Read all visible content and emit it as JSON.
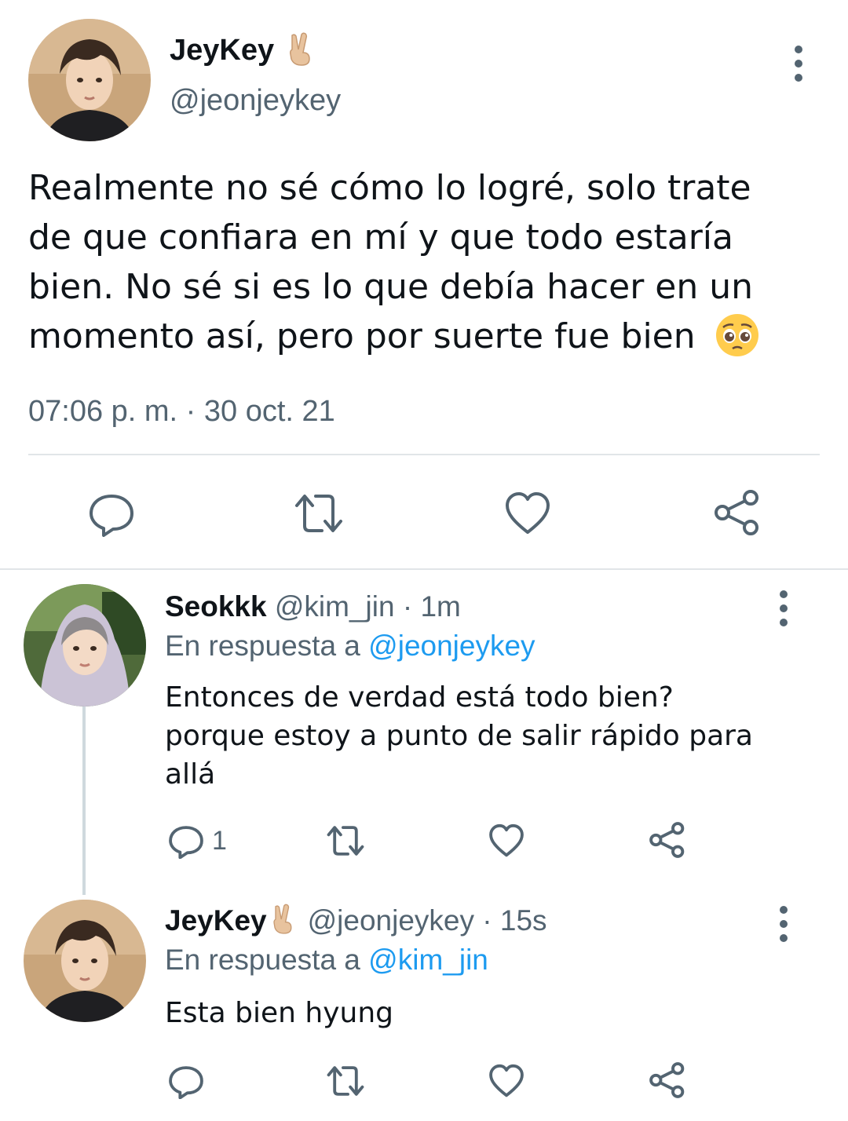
{
  "main_tweet": {
    "author_name": "JeyKey",
    "handle": "@jeonjeykey",
    "text": "Realmente no sé cómo lo logré, solo trate de que confiara en mí y que todo estaría bien. No sé si es lo que debía hacer en un momento así, pero por suerte fue bien",
    "text_lines": [
      "Realmente no sé cómo lo logré, solo trate",
      "de que confiara en mí y que todo estaría",
      "bien. No sé si es lo que debía hacer en un",
      "momento así, pero por suerte fue bien"
    ],
    "timestamp": "07:06 p. m. · 30 oct. 21",
    "author_emoji": "victory-hand-emoji",
    "text_emoji": "pleading-face-emoji",
    "actions": [
      "reply-icon",
      "retweet-icon",
      "like-icon",
      "share-icon"
    ]
  },
  "replies": [
    {
      "author_name": "Seokkk",
      "handle": "@kim_jin",
      "time": "· 1m",
      "reply_prefix": "En respuesta a",
      "reply_to": "@jeonjeykey",
      "text_lines": [
        "Entonces de verdad está todo bien?",
        "porque estoy a punto de salir rápido para",
        "allá"
      ],
      "reply_count": "1"
    },
    {
      "author_name": "JeyKey",
      "handle": "@jeonjeykey",
      "time": "· 15s",
      "reply_prefix": "En respuesta a",
      "reply_to": "@kim_jin",
      "text_lines": [
        "Esta bien hyung"
      ],
      "reply_count": ""
    }
  ],
  "colors": {
    "text": "#0f1419",
    "secondary": "#536471",
    "link": "#1d9bf0",
    "divider": "#e1e5e8",
    "thread_line": "#cfd9de"
  }
}
